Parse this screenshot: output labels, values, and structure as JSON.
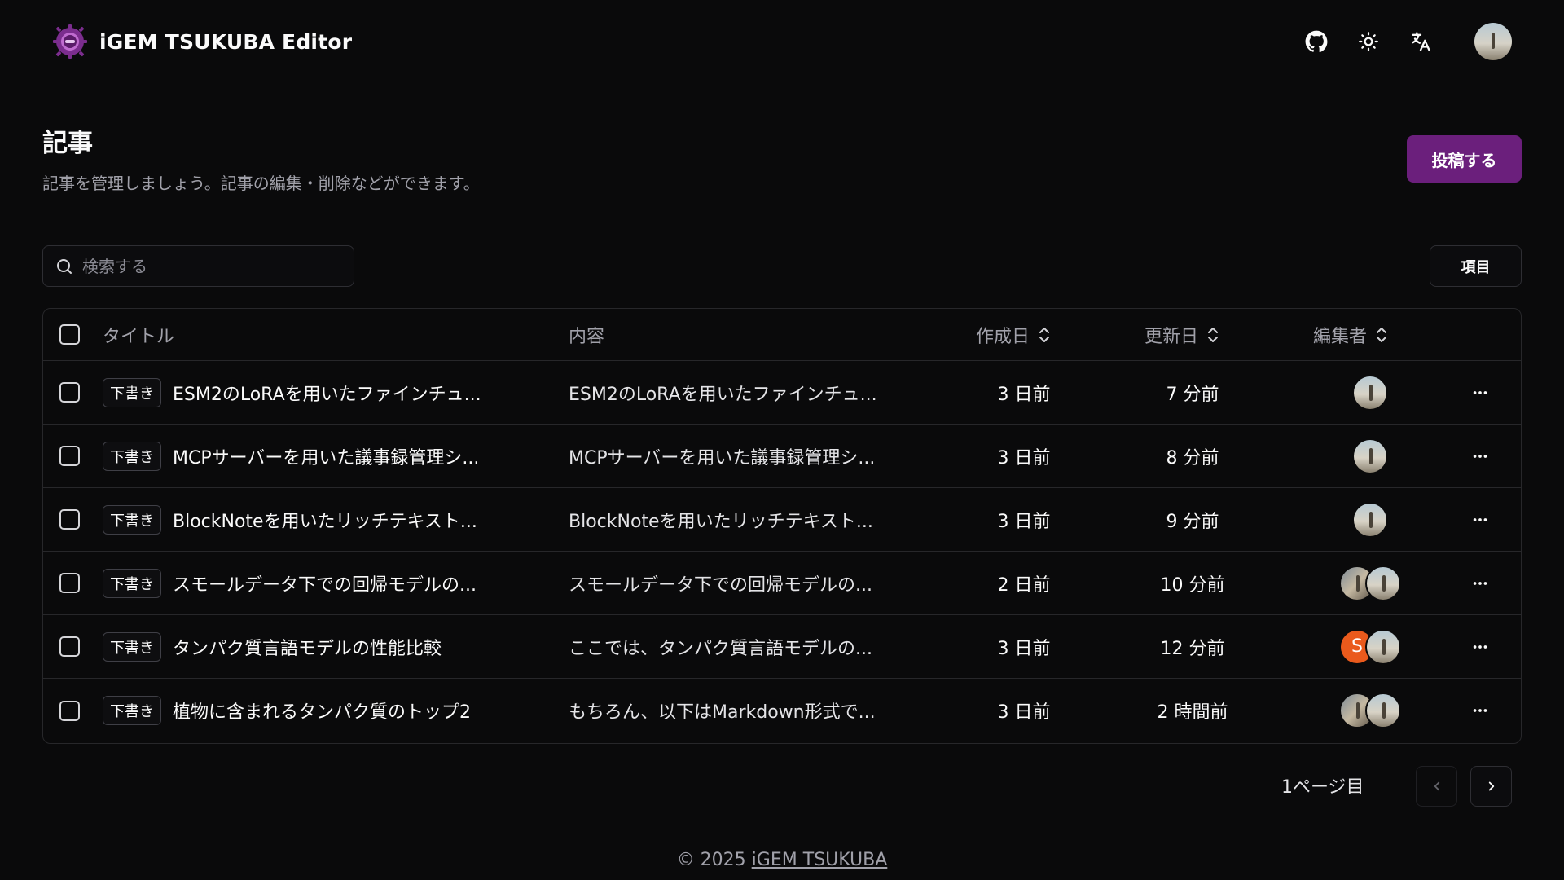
{
  "header": {
    "brand_name": "iGEM TSUKUBA Editor",
    "icons": [
      "github-icon",
      "sun-icon",
      "translate-icon"
    ]
  },
  "page": {
    "title": "記事",
    "description": "記事を管理しましょう。記事の編集・削除などができます。",
    "post_button": "投稿する"
  },
  "toolbar": {
    "search_placeholder": "検索する",
    "columns_button": "項目"
  },
  "table": {
    "headers": {
      "title": "タイトル",
      "content": "内容",
      "created": "作成日",
      "updated": "更新日",
      "editors": "編集者"
    },
    "rows": [
      {
        "badge": "下書き",
        "title": "ESM2のLoRAを用いたファインチュ...",
        "content": "ESM2のLoRAを用いたファインチュ...",
        "created": "3 日前",
        "updated": "7 分前",
        "editors": [
          "photo"
        ]
      },
      {
        "badge": "下書き",
        "title": "MCPサーバーを用いた議事録管理シ...",
        "content": "MCPサーバーを用いた議事録管理シ...",
        "created": "3 日前",
        "updated": "8 分前",
        "editors": [
          "photo"
        ]
      },
      {
        "badge": "下書き",
        "title": "BlockNoteを用いたリッチテキスト...",
        "content": "BlockNoteを用いたリッチテキスト...",
        "created": "3 日前",
        "updated": "9 分前",
        "editors": [
          "photo"
        ]
      },
      {
        "badge": "下書き",
        "title": "スモールデータ下での回帰モデルの...",
        "content": "スモールデータ下での回帰モデルの...",
        "created": "2 日前",
        "updated": "10 分前",
        "editors": [
          "photo-alt",
          "photo"
        ]
      },
      {
        "badge": "下書き",
        "title": "タンパク質言語モデルの性能比較",
        "content": "ここでは、タンパク質言語モデルの...",
        "created": "3 日前",
        "updated": "12 分前",
        "editors": [
          "S",
          "photo"
        ]
      },
      {
        "badge": "下書き",
        "title": "植物に含まれるタンパク質のトップ2",
        "content": "もちろん、以下はMarkdown形式で...",
        "created": "3 日前",
        "updated": "2 時間前",
        "editors": [
          "photo-alt",
          "photo"
        ]
      }
    ]
  },
  "pagination": {
    "label": "1ページ目"
  },
  "footer": {
    "copyright": "© 2025 ",
    "link_text": "iGEM TSUKUBA"
  },
  "colors": {
    "background": "#0a0a0b",
    "accent": "#6b1f7c",
    "badge_avatar": "#ea5a1c"
  }
}
